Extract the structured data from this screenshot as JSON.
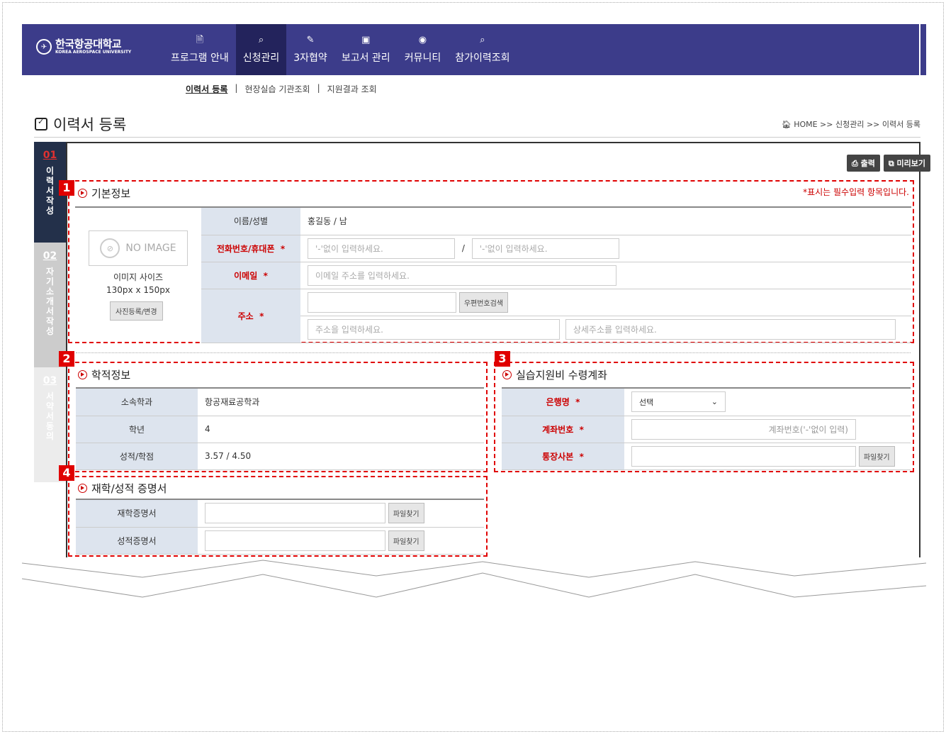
{
  "university": {
    "name_kr": "한국항공대학교",
    "name_en": "KOREA AEROSPACE UNIVERSITY"
  },
  "nav": [
    {
      "label": "프로그램 안내",
      "icon": "document-icon",
      "glyph": "🗎"
    },
    {
      "label": "신청관리",
      "icon": "search-doc-icon",
      "glyph": "⌕"
    },
    {
      "label": "3자협약",
      "icon": "edit-icon",
      "glyph": "✎"
    },
    {
      "label": "보고서 관리",
      "icon": "folder-icon",
      "glyph": "▣"
    },
    {
      "label": "커뮤니티",
      "icon": "broadcast-icon",
      "glyph": "◉"
    },
    {
      "label": "참가이력조회",
      "icon": "search-doc-icon",
      "glyph": "⌕"
    }
  ],
  "subnav": {
    "items": [
      "이력서 등록",
      "현장실습 기관조회",
      "지원결과 조회"
    ],
    "sep": "|"
  },
  "page_title": "이력서 등록",
  "breadcrumb": "HOME >> 신청관리 >> 이력서 등록",
  "steps": [
    {
      "num": "01",
      "label": "이력서작성"
    },
    {
      "num": "02",
      "label": "자기소개서작성"
    },
    {
      "num": "03",
      "label": "서약서동의"
    }
  ],
  "buttons": {
    "print": "출력",
    "preview": "미리보기"
  },
  "required_note": "*표시는 필수입력 항목입니다.",
  "badges": [
    "1",
    "2",
    "3",
    "4"
  ],
  "basic": {
    "title": "기본정보",
    "no_image": "NO IMAGE",
    "image_size_label": "이미지 사이즈",
    "image_size_value": "130px x 150px",
    "photo_button": "사진등록/변경",
    "name_label": "이름/성별",
    "name_value": "홍길동 / 남",
    "phone_label": "전화번호/휴대폰",
    "phone_placeholder": "'-'없이 입력하세요.",
    "phone_sep": "/",
    "email_label": "이메일",
    "email_placeholder": "이메일 주소를 입력하세요.",
    "addr_label": "주소",
    "zip_button": "우편번호검색",
    "addr_placeholder": "주소을 입력하세요.",
    "addr_detail_placeholder": "상세주소를 입력하세요.",
    "star": "*"
  },
  "academic": {
    "title": "학적정보",
    "rows": [
      {
        "label": "소속학과",
        "value": "항공재료공학과"
      },
      {
        "label": "학년",
        "value": "4"
      },
      {
        "label": "성적/학점",
        "value": "3.57 / 4.50"
      }
    ]
  },
  "bank": {
    "title": "실습지원비 수령계좌",
    "bank_label": "은행명",
    "bank_select": "선택",
    "account_label": "계좌번호",
    "account_placeholder": "계좌번호('-'없이 입력)",
    "copy_label": "통장사본",
    "file_button": "파일찾기"
  },
  "certs": {
    "title": "재학/성적 증명서",
    "rows": [
      {
        "label": "재학증명서",
        "button": "파일찾기"
      },
      {
        "label": "성적증명서",
        "button": "파일찾기"
      }
    ]
  }
}
